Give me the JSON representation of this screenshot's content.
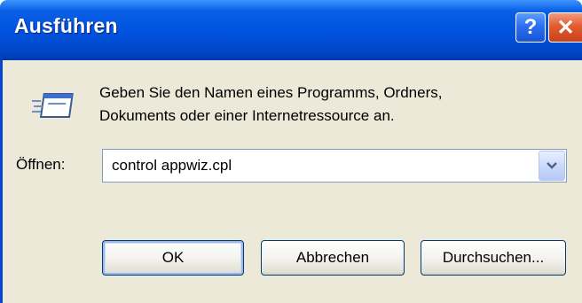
{
  "window": {
    "title": "Ausführen",
    "help_label": "?",
    "close_label": "✕"
  },
  "dialog": {
    "description_line1": "Geben Sie den Namen eines Programms, Ordners,",
    "description_line2": "Dokuments oder einer Internetressource an.",
    "open_label": "Öffnen:",
    "open_value": "control appwiz.cpl"
  },
  "buttons": {
    "ok": "OK",
    "cancel": "Abbrechen",
    "browse": "Durchsuchen..."
  },
  "icons": {
    "run": "run-program-icon",
    "dropdown": "chevron-down-icon"
  },
  "colors": {
    "titlebar": "#0052de",
    "face": "#ece9d8",
    "close": "#e25c2f"
  }
}
